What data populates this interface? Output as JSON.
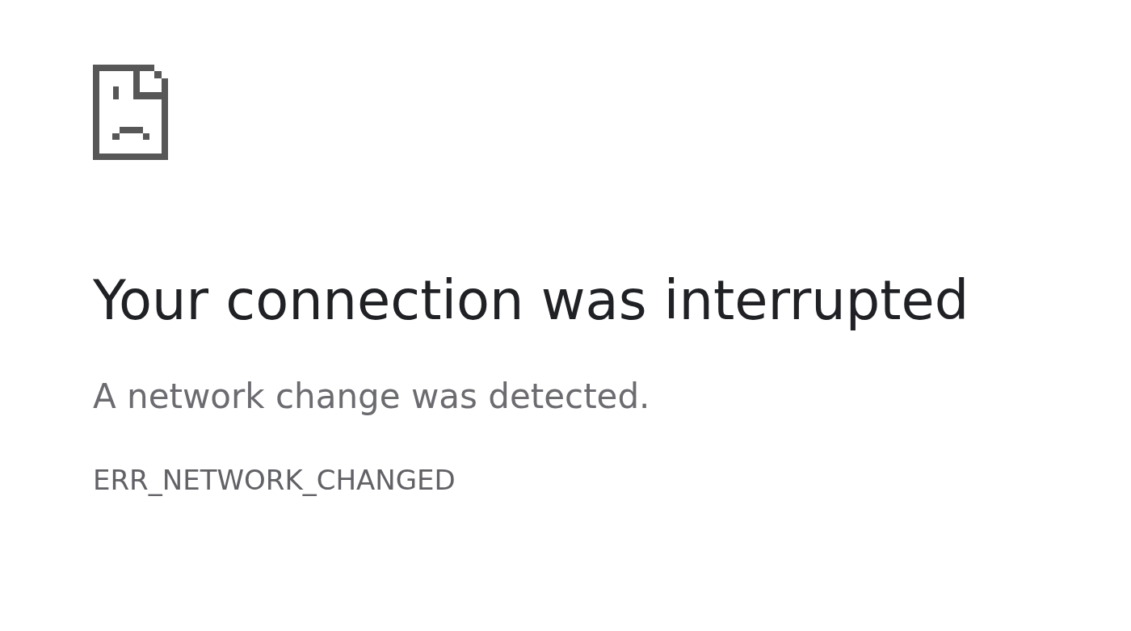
{
  "error_page": {
    "title": "Your connection was interrupted",
    "message": "A network change was detected.",
    "error_code": "ERR_NETWORK_CHANGED"
  }
}
